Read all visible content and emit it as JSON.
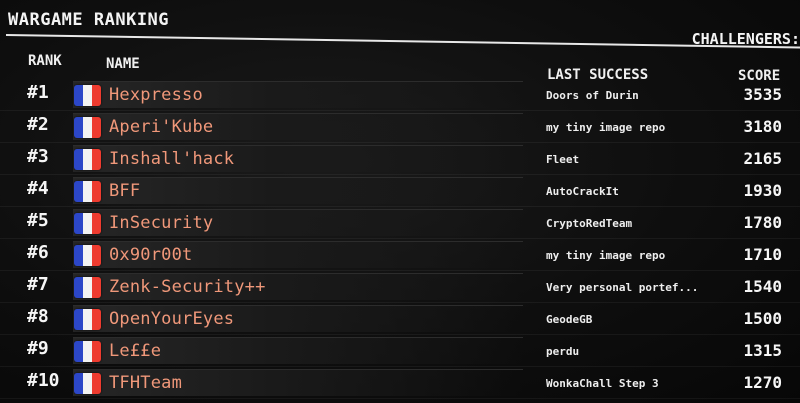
{
  "header": {
    "title": "WARGAME RANKING",
    "challengers_label": "CHALLENGERS:"
  },
  "columns": {
    "rank": "RANK",
    "name": "NAME",
    "last_success": "LAST SUCCESS",
    "score": "SCORE"
  },
  "flag_icon": "france-flag-icon",
  "colors": {
    "team_name": "#f0987a",
    "flag_blue": "#2c47c8",
    "flag_white": "#f3f3f3",
    "flag_red": "#ee3b2f"
  },
  "rows": [
    {
      "rank": "#1",
      "name": "Hexpresso",
      "last_success": "Doors of Durin",
      "score": "3535"
    },
    {
      "rank": "#2",
      "name": "Aperi'Kube",
      "last_success": "my tiny image repo",
      "score": "3180"
    },
    {
      "rank": "#3",
      "name": "Inshall'hack",
      "last_success": "Fleet",
      "score": "2165"
    },
    {
      "rank": "#4",
      "name": "BFF",
      "last_success": "AutoCrackIt",
      "score": "1930"
    },
    {
      "rank": "#5",
      "name": "InSecurity",
      "last_success": "CryptoRedTeam",
      "score": "1780"
    },
    {
      "rank": "#6",
      "name": "0x90r00t",
      "last_success": "my tiny image repo",
      "score": "1710"
    },
    {
      "rank": "#7",
      "name": "Zenk-Security++",
      "last_success": "Very personal portef...",
      "score": "1540"
    },
    {
      "rank": "#8",
      "name": "OpenYourEyes",
      "last_success": "GeodeGB",
      "score": "1500"
    },
    {
      "rank": "#9",
      "name": "Le££e",
      "last_success": "perdu",
      "score": "1315"
    },
    {
      "rank": "#10",
      "name": "TFHTeam",
      "last_success": "WonkaChall Step 3",
      "score": "1270"
    }
  ]
}
